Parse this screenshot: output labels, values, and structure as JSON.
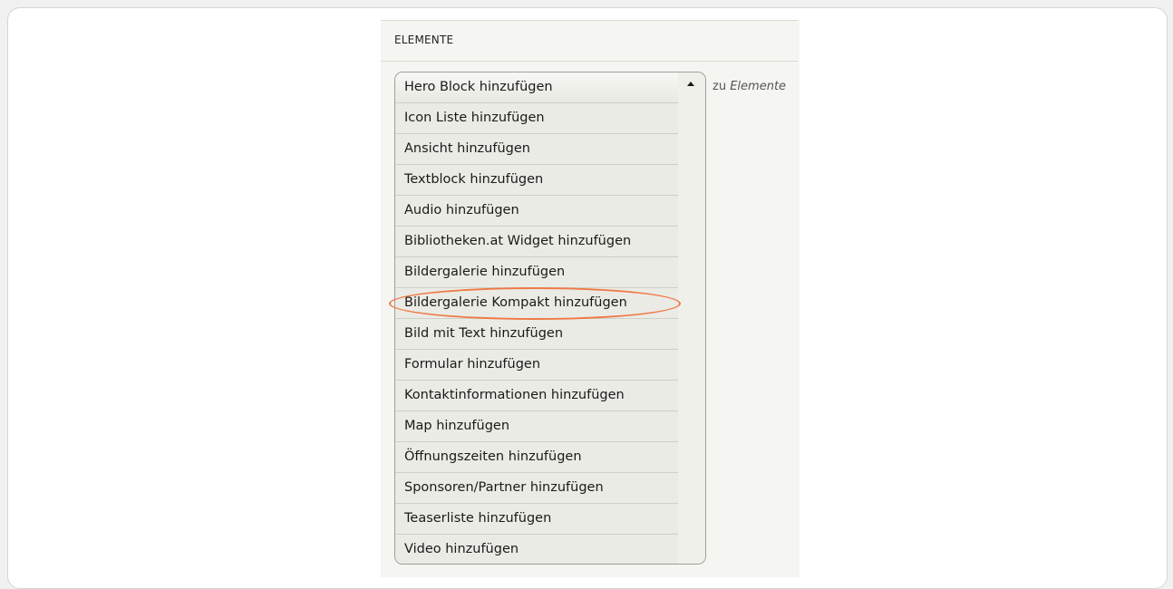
{
  "section": {
    "title": "ELEMENTE"
  },
  "dropdown": {
    "items": [
      "Hero Block hinzufügen",
      "Icon Liste hinzufügen",
      "Ansicht hinzufügen",
      "Textblock hinzufügen",
      "Audio hinzufügen",
      "Bibliotheken.at Widget hinzufügen",
      "Bildergalerie hinzufügen",
      "Bildergalerie Kompakt hinzufügen",
      "Bild mit Text hinzufügen",
      "Formular hinzufügen",
      "Kontaktinformationen hinzufügen",
      "Map hinzufügen",
      "Öffnungszeiten hinzufügen",
      "Sponsoren/Partner hinzufügen",
      "Teaserliste hinzufügen",
      "Video hinzufügen"
    ],
    "toggle_icon": "caret-up-icon"
  },
  "suffix": {
    "prefix": "zu",
    "target": "Elemente"
  },
  "highlight": {
    "item": "Bildergalerie Kompakt hinzufügen",
    "color": "#ee7a45"
  }
}
